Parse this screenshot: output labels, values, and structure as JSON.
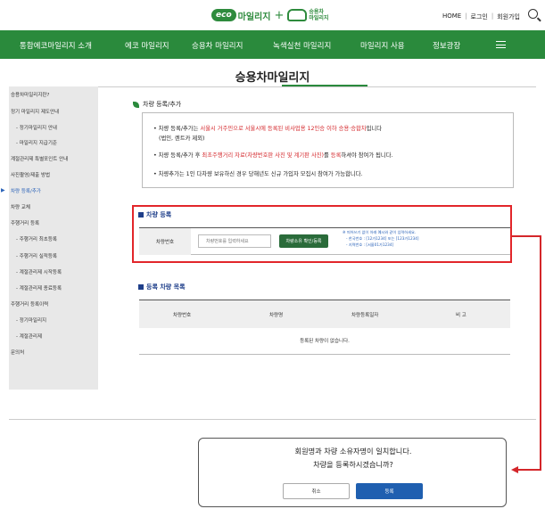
{
  "header": {
    "logo_eco": "eco",
    "logo_text": "마일리지",
    "logo_sub_1": "승용차",
    "logo_sub_2": "마일리지",
    "links": [
      "HOME",
      "로그인",
      "회원가입"
    ],
    "separator": "|"
  },
  "nav": {
    "items": [
      "통합에코마일리지 소개",
      "에코 마일리지",
      "승용차 마일리지",
      "녹색실천 마일리지",
      "마일리지 사용",
      "정보광장"
    ]
  },
  "page": {
    "title": "승용차마일리지"
  },
  "sidebar": {
    "items": [
      "승용차마일리지란?",
      "정기 마일리지 제도안내",
      "- 정기마일리지 안내",
      "- 마일리지 지급기준",
      "계절관리제 특별포인트 안내",
      "사진촬영/제출 방법",
      "차량 등록/추가",
      "차량 교체",
      "주행거리 등록",
      "- 주행거리 최초등록",
      "- 주행거리 실적등록",
      "- 계절관리제 시작등록",
      "- 계절관리제 종료등록",
      "주행거리 등록이력",
      "- 정기마일리지",
      "- 계절관리제",
      "문의처"
    ],
    "active_index": 6
  },
  "content": {
    "section_title": "차량 등록/추가",
    "notice": {
      "line1_a": "차량 등록/추가는 ",
      "line1_red": "서울시 거주민으로 서울시에 등록된 비사업용 12인승 이하 승용·승합차",
      "line1_b": "입니다",
      "line1_sub": "(법인, 렌트카 제외)",
      "line2_a": "차량 등록/추가 후 ",
      "line2_red1": "최초주행거리 자료(차량번호판 사진 및 계기판 사진)",
      "line2_b": "를 ",
      "line2_red2": "등록",
      "line2_c": "하셔야 참여가 됩니다.",
      "line3": "차량추가는 1인 다차량 보유하신 경우 당해년도 신규 가입자 모집시 참여가 가능합니다."
    },
    "registration": {
      "heading": "차량 등록",
      "label": "차량번호",
      "input_placeholder": "차량번호를 입력하세요",
      "button": "차량소유 확인/등록",
      "hint1": "※ 띄어쓰기 없이 아래 예시와 같이 입력하세요.",
      "hint2": "- 한국번호 : [12가1234] 또는 [123가1234]",
      "hint3": "- 지역번호 : [서울01가1234]"
    },
    "list": {
      "heading": "등록 차량 목록",
      "columns": [
        "차량번호",
        "차량명",
        "차량등록일자",
        "비 고"
      ],
      "empty": "등록된 차량이 없습니다."
    }
  },
  "dialog": {
    "line1": "회원명과 차량 소유자명이 일치합니다.",
    "line2": "차량을 등록하시겠습니까?",
    "cancel": "취소",
    "confirm": "등록"
  },
  "colors": {
    "green": "#2a8a3c",
    "red": "#d4262a",
    "blue": "#1f5fb0"
  }
}
